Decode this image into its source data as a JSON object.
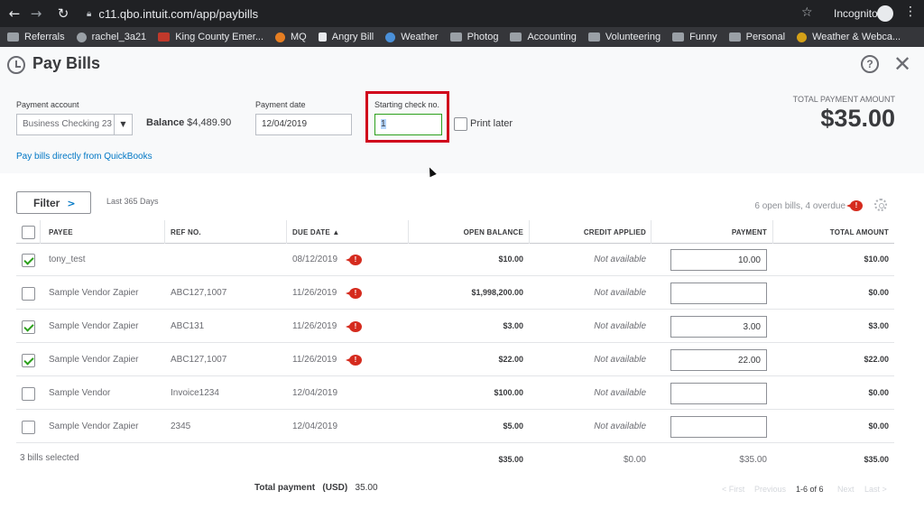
{
  "browser": {
    "url": "c11.qbo.intuit.com/app/paybills",
    "profile": "Incognito",
    "bookmarks": [
      "Referrals",
      "rachel_3a21",
      "King County Emer...",
      "MQ",
      "Angry Bill",
      "Weather",
      "Photog",
      "Accounting",
      "Volunteering",
      "Funny",
      "Personal",
      "Weather & Webca..."
    ]
  },
  "header": {
    "title": "Pay Bills",
    "help_icon": "?",
    "close_icon": "✕"
  },
  "form": {
    "payment_account_label": "Payment account",
    "payment_account_value": "Business Checking 23",
    "balance_label": "Balance",
    "balance_value": "$4,489.90",
    "payment_date_label": "Payment date",
    "payment_date_value": "12/04/2019",
    "starting_check_label": "Starting check no.",
    "starting_check_value": "1",
    "print_later_label": "Print later",
    "total_label": "TOTAL PAYMENT AMOUNT",
    "total_value": "$35.00",
    "pay_link": "Pay bills directly from QuickBooks"
  },
  "toolbar": {
    "filter_label": "Filter",
    "filter_range": "Last 365 Days",
    "open_bills": "6 open bills, 4 overdue"
  },
  "table": {
    "columns": [
      "PAYEE",
      "REF NO.",
      "DUE DATE ▲",
      "OPEN BALANCE",
      "CREDIT APPLIED",
      "PAYMENT",
      "TOTAL AMOUNT"
    ],
    "rows": [
      {
        "payee": "tony_test",
        "ref": "",
        "due": "08/12/2019",
        "overdue": true,
        "open": "$10.00",
        "credit": "Not available",
        "payment": "10.00",
        "total": "$10.00",
        "checked": true
      },
      {
        "payee": "Sample Vendor Zapier",
        "ref": "ABC127,1007",
        "due": "11/26/2019",
        "overdue": true,
        "open": "$1,998,200.00",
        "credit": "Not available",
        "payment": "",
        "total": "$0.00",
        "checked": false
      },
      {
        "payee": "Sample Vendor Zapier",
        "ref": "ABC131",
        "due": "11/26/2019",
        "overdue": true,
        "open": "$3.00",
        "credit": "Not available",
        "payment": "3.00",
        "total": "$3.00",
        "checked": true
      },
      {
        "payee": "Sample Vendor Zapier",
        "ref": "ABC127,1007",
        "due": "11/26/2019",
        "overdue": true,
        "open": "$22.00",
        "credit": "Not available",
        "payment": "22.00",
        "total": "$22.00",
        "checked": true
      },
      {
        "payee": "Sample Vendor",
        "ref": "Invoice1234",
        "due": "12/04/2019",
        "overdue": false,
        "open": "$100.00",
        "credit": "Not available",
        "payment": "",
        "total": "$0.00",
        "checked": false
      },
      {
        "payee": "Sample Vendor Zapier",
        "ref": "2345",
        "due": "12/04/2019",
        "overdue": false,
        "open": "$5.00",
        "credit": "Not available",
        "payment": "",
        "total": "$0.00",
        "checked": false
      }
    ],
    "totals": {
      "selected": "3 bills selected",
      "open": "$35.00",
      "credit": "$0.00",
      "payment": "$35.00",
      "total": "$35.00"
    }
  },
  "footer": {
    "total_payment_label": "Total payment",
    "currency": "(USD)",
    "total_payment_value": "35.00",
    "pager": {
      "first": "< First",
      "previous": "Previous",
      "range": "1-6 of 6",
      "next": "Next",
      "last": "Last >"
    }
  },
  "colors": {
    "accent": "#2ca01c",
    "link": "#0077c5",
    "highlight": "#d0021b",
    "overdue": "#d52b1e"
  }
}
